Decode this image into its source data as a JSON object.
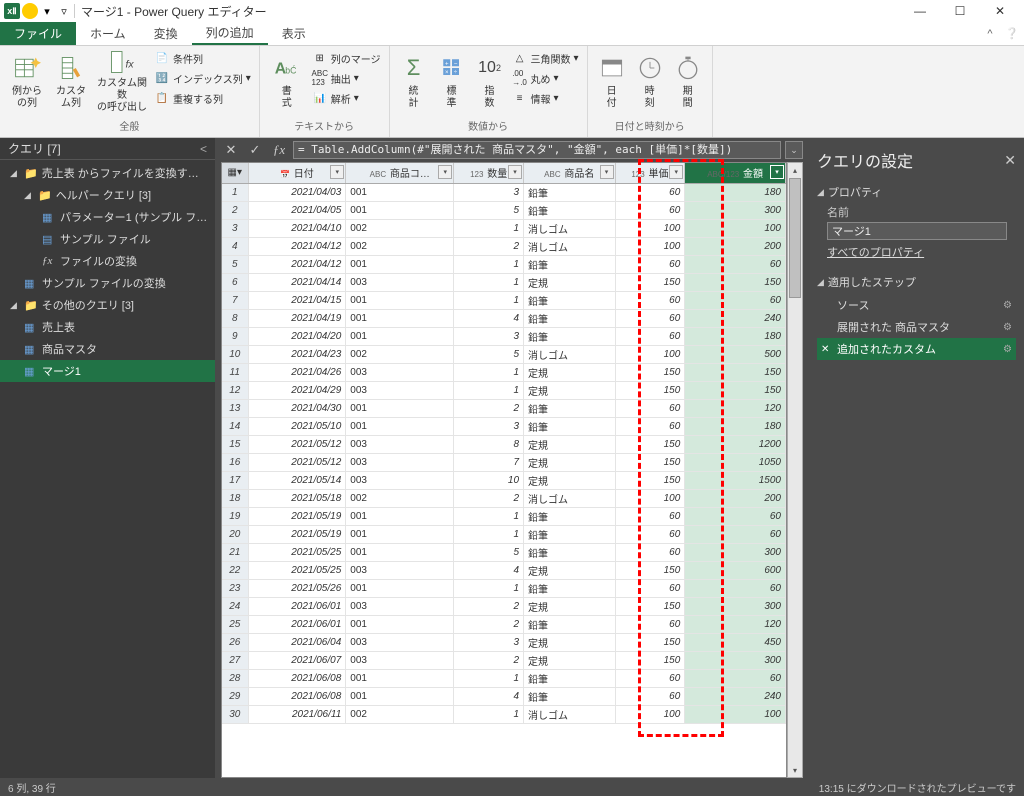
{
  "titlebar": {
    "app_abbrev": "xⅡ",
    "title": "マージ1 - Power Query エディター"
  },
  "tabs": {
    "file": "ファイル",
    "home": "ホーム",
    "transform": "変換",
    "addcolumn": "列の追加",
    "view": "表示"
  },
  "ribbon": {
    "general": {
      "label": "全般",
      "examples": "例から\nの列",
      "custom": "カスタ\nム列",
      "invoke": "カスタム関数\nの呼び出し",
      "conditional": "条件列",
      "index": "インデックス列",
      "duplicate": "重複する列"
    },
    "text": {
      "label": "テキストから",
      "format": "書\n式",
      "merge": "列のマージ",
      "extract": "抽出",
      "parse": "解析"
    },
    "number": {
      "label": "数値から",
      "statistics": "統\n計",
      "standard": "標\n準",
      "exponent": "指\n数",
      "trig": "三角関数",
      "rounding": "丸め",
      "info": "情報"
    },
    "datetime": {
      "label": "日付と時刻から",
      "date": "日\n付",
      "time": "時\n刻",
      "duration": "期\n間"
    }
  },
  "queries": {
    "header": "クエリ [7]",
    "items": [
      {
        "kind": "group",
        "level": 1,
        "label": "売上表 からファイルを変換す…"
      },
      {
        "kind": "group",
        "level": 2,
        "label": "ヘルパー クエリ [3]"
      },
      {
        "kind": "query",
        "level": 3,
        "icon": "table",
        "label": "パラメーター1 (サンプル フ…"
      },
      {
        "kind": "query",
        "level": 3,
        "icon": "file",
        "label": "サンプル ファイル"
      },
      {
        "kind": "query",
        "level": 3,
        "icon": "fx",
        "label": "ファイルの変換"
      },
      {
        "kind": "query",
        "level": 2,
        "icon": "table",
        "label": "サンプル ファイルの変換"
      },
      {
        "kind": "group",
        "level": 1,
        "label": "その他のクエリ [3]"
      },
      {
        "kind": "query",
        "level": 2,
        "icon": "table",
        "label": "売上表"
      },
      {
        "kind": "query",
        "level": 2,
        "icon": "table",
        "label": "商品マスタ"
      },
      {
        "kind": "query",
        "level": 2,
        "icon": "table",
        "label": "マージ1",
        "selected": true
      }
    ]
  },
  "formula": "= Table.AddColumn(#\"展開された 商品マスタ\", \"金額\", each [単価]*[数量])",
  "column_headers": [
    {
      "key": "date",
      "label": "日付",
      "type": "📅"
    },
    {
      "key": "code",
      "label": "商品コ…",
      "type": "ABC"
    },
    {
      "key": "qty",
      "label": "数量",
      "type": "123"
    },
    {
      "key": "name",
      "label": "商品名",
      "type": "ABC"
    },
    {
      "key": "price",
      "label": "単価",
      "type": "123"
    },
    {
      "key": "amount",
      "label": "金額",
      "type": "ABC/123",
      "highlight": true
    }
  ],
  "rows": [
    {
      "n": 1,
      "date": "2021/04/03",
      "code": "001",
      "qty": 3,
      "name": "鉛筆",
      "price": 60,
      "amount": 180
    },
    {
      "n": 2,
      "date": "2021/04/05",
      "code": "001",
      "qty": 5,
      "name": "鉛筆",
      "price": 60,
      "amount": 300
    },
    {
      "n": 3,
      "date": "2021/04/10",
      "code": "002",
      "qty": 1,
      "name": "消しゴム",
      "price": 100,
      "amount": 100
    },
    {
      "n": 4,
      "date": "2021/04/12",
      "code": "002",
      "qty": 2,
      "name": "消しゴム",
      "price": 100,
      "amount": 200
    },
    {
      "n": 5,
      "date": "2021/04/12",
      "code": "001",
      "qty": 1,
      "name": "鉛筆",
      "price": 60,
      "amount": 60
    },
    {
      "n": 6,
      "date": "2021/04/14",
      "code": "003",
      "qty": 1,
      "name": "定規",
      "price": 150,
      "amount": 150
    },
    {
      "n": 7,
      "date": "2021/04/15",
      "code": "001",
      "qty": 1,
      "name": "鉛筆",
      "price": 60,
      "amount": 60
    },
    {
      "n": 8,
      "date": "2021/04/19",
      "code": "001",
      "qty": 4,
      "name": "鉛筆",
      "price": 60,
      "amount": 240
    },
    {
      "n": 9,
      "date": "2021/04/20",
      "code": "001",
      "qty": 3,
      "name": "鉛筆",
      "price": 60,
      "amount": 180
    },
    {
      "n": 10,
      "date": "2021/04/23",
      "code": "002",
      "qty": 5,
      "name": "消しゴム",
      "price": 100,
      "amount": 500
    },
    {
      "n": 11,
      "date": "2021/04/26",
      "code": "003",
      "qty": 1,
      "name": "定規",
      "price": 150,
      "amount": 150
    },
    {
      "n": 12,
      "date": "2021/04/29",
      "code": "003",
      "qty": 1,
      "name": "定規",
      "price": 150,
      "amount": 150
    },
    {
      "n": 13,
      "date": "2021/04/30",
      "code": "001",
      "qty": 2,
      "name": "鉛筆",
      "price": 60,
      "amount": 120
    },
    {
      "n": 14,
      "date": "2021/05/10",
      "code": "001",
      "qty": 3,
      "name": "鉛筆",
      "price": 60,
      "amount": 180
    },
    {
      "n": 15,
      "date": "2021/05/12",
      "code": "003",
      "qty": 8,
      "name": "定規",
      "price": 150,
      "amount": 1200
    },
    {
      "n": 16,
      "date": "2021/05/12",
      "code": "003",
      "qty": 7,
      "name": "定規",
      "price": 150,
      "amount": 1050
    },
    {
      "n": 17,
      "date": "2021/05/14",
      "code": "003",
      "qty": 10,
      "name": "定規",
      "price": 150,
      "amount": 1500
    },
    {
      "n": 18,
      "date": "2021/05/18",
      "code": "002",
      "qty": 2,
      "name": "消しゴム",
      "price": 100,
      "amount": 200
    },
    {
      "n": 19,
      "date": "2021/05/19",
      "code": "001",
      "qty": 1,
      "name": "鉛筆",
      "price": 60,
      "amount": 60
    },
    {
      "n": 20,
      "date": "2021/05/19",
      "code": "001",
      "qty": 1,
      "name": "鉛筆",
      "price": 60,
      "amount": 60
    },
    {
      "n": 21,
      "date": "2021/05/25",
      "code": "001",
      "qty": 5,
      "name": "鉛筆",
      "price": 60,
      "amount": 300
    },
    {
      "n": 22,
      "date": "2021/05/25",
      "code": "003",
      "qty": 4,
      "name": "定規",
      "price": 150,
      "amount": 600
    },
    {
      "n": 23,
      "date": "2021/05/26",
      "code": "001",
      "qty": 1,
      "name": "鉛筆",
      "price": 60,
      "amount": 60
    },
    {
      "n": 24,
      "date": "2021/06/01",
      "code": "003",
      "qty": 2,
      "name": "定規",
      "price": 150,
      "amount": 300
    },
    {
      "n": 25,
      "date": "2021/06/01",
      "code": "001",
      "qty": 2,
      "name": "鉛筆",
      "price": 60,
      "amount": 120
    },
    {
      "n": 26,
      "date": "2021/06/04",
      "code": "003",
      "qty": 3,
      "name": "定規",
      "price": 150,
      "amount": 450
    },
    {
      "n": 27,
      "date": "2021/06/07",
      "code": "003",
      "qty": 2,
      "name": "定規",
      "price": 150,
      "amount": 300
    },
    {
      "n": 28,
      "date": "2021/06/08",
      "code": "001",
      "qty": 1,
      "name": "鉛筆",
      "price": 60,
      "amount": 60
    },
    {
      "n": 29,
      "date": "2021/06/08",
      "code": "001",
      "qty": 4,
      "name": "鉛筆",
      "price": 60,
      "amount": 240
    },
    {
      "n": 30,
      "date": "2021/06/11",
      "code": "002",
      "qty": 1,
      "name": "消しゴム",
      "price": 100,
      "amount": 100
    }
  ],
  "settings": {
    "title": "クエリの設定",
    "properties_header": "プロパティ",
    "name_label": "名前",
    "name_value": "マージ1",
    "all_props": "すべてのプロパティ",
    "steps_header": "適用したステップ",
    "steps": [
      {
        "label": "ソース",
        "gear": true
      },
      {
        "label": "展開された 商品マスタ",
        "gear": true
      },
      {
        "label": "追加されたカスタム",
        "gear": true,
        "selected": true,
        "xmark": true
      }
    ]
  },
  "status": {
    "left": "6 列, 39 行",
    "right": "13:15 にダウンロードされたプレビューです"
  }
}
